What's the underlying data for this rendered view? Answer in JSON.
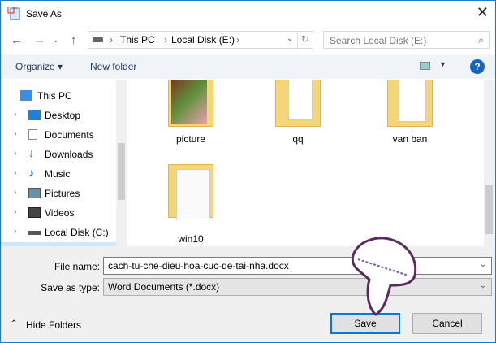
{
  "title": "Save As",
  "address": {
    "crumbs": [
      "This PC",
      "Local Disk (E:)"
    ],
    "search_placeholder": "Search Local Disk (E:)"
  },
  "toolbar": {
    "organize": "Organize ▾",
    "new_folder": "New folder",
    "help": "?"
  },
  "nav": [
    {
      "label": "This PC",
      "icon": "pc-icon"
    },
    {
      "label": "Desktop",
      "icon": "desktop-icon"
    },
    {
      "label": "Documents",
      "icon": "documents-icon"
    },
    {
      "label": "Downloads",
      "icon": "downloads-icon"
    },
    {
      "label": "Music",
      "icon": "music-icon"
    },
    {
      "label": "Pictures",
      "icon": "pictures-icon"
    },
    {
      "label": "Videos",
      "icon": "videos-icon"
    },
    {
      "label": "Local Disk (C:)",
      "icon": "drive-icon"
    }
  ],
  "folders": [
    {
      "label": "picture"
    },
    {
      "label": "qq"
    },
    {
      "label": "van ban"
    },
    {
      "label": "win10"
    }
  ],
  "form": {
    "file_name_label": "File name:",
    "file_name": "cach-tu-che-dieu-hoa-cuc-de-tai-nha.docx",
    "type_label": "Save as type:",
    "type": "Word Documents (*.docx)"
  },
  "buttons": {
    "hide_folders": "Hide Folders",
    "save": "Save",
    "cancel": "Cancel"
  }
}
